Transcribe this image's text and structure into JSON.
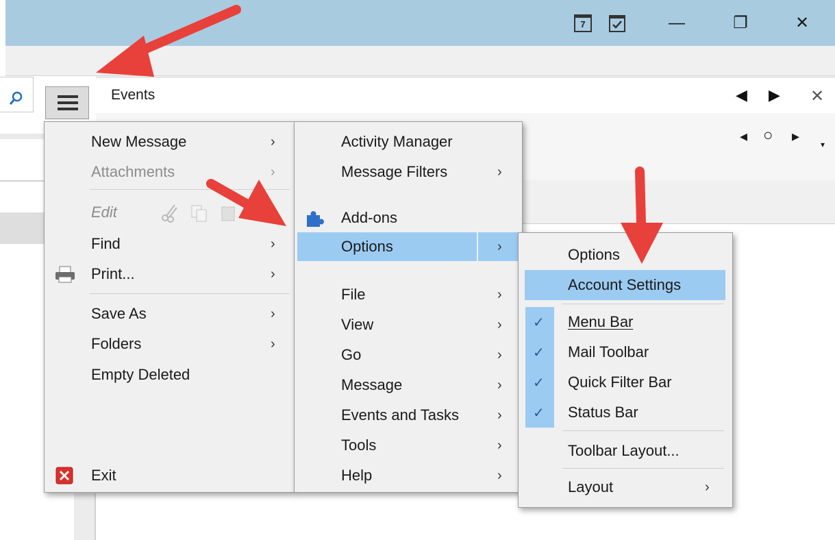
{
  "window": {
    "minimize_glyph": "—",
    "restore_glyph": "❐",
    "close_glyph": "✕"
  },
  "calendar_icons": {
    "calendar_day": "7"
  },
  "events": {
    "title": "Events",
    "prev_glyph": "◀",
    "next_glyph": "▶",
    "close_glyph": "✕",
    "mini_nav": {
      "prev": "◂",
      "today": "○",
      "next": "▸",
      "more": "▾"
    }
  },
  "main_menu": {
    "items": [
      {
        "label": "New Message",
        "arrow": "›"
      },
      {
        "label": "Attachments",
        "arrow": "›"
      },
      {
        "label": "Edit",
        "arrow": "›"
      },
      {
        "label": "Find",
        "arrow": "›"
      },
      {
        "label": "Print...",
        "arrow": "›"
      },
      {
        "label": "Save As",
        "arrow": "›"
      },
      {
        "label": "Folders",
        "arrow": "›"
      },
      {
        "label": "Empty Deleted"
      },
      {
        "label": "Exit"
      }
    ]
  },
  "sub_menu": {
    "items": [
      {
        "label": "Activity Manager"
      },
      {
        "label": "Message Filters",
        "arrow": "›"
      },
      {
        "label": "Add-ons"
      },
      {
        "label": "Options",
        "arrow": "›"
      },
      {
        "label": "File",
        "arrow": "›"
      },
      {
        "label": "View",
        "arrow": "›"
      },
      {
        "label": "Go",
        "arrow": "›"
      },
      {
        "label": "Message",
        "arrow": "›"
      },
      {
        "label": "Events and Tasks",
        "arrow": "›"
      },
      {
        "label": "Tools",
        "arrow": "›"
      },
      {
        "label": "Help",
        "arrow": "›"
      }
    ]
  },
  "options_menu": {
    "items": [
      {
        "label": "Options"
      },
      {
        "label": "Account Settings"
      },
      {
        "label": "Menu Bar",
        "checked": true,
        "access_key": "M"
      },
      {
        "label": "Mail Toolbar",
        "checked": true,
        "access_key": "o"
      },
      {
        "label": "Quick Filter Bar",
        "checked": true
      },
      {
        "label": "Status Bar",
        "checked": true,
        "access_key": "S"
      },
      {
        "label": "Toolbar Layout..."
      },
      {
        "label": "Layout",
        "arrow": "›"
      }
    ],
    "check_glyph": "✓"
  },
  "colors": {
    "title_bar": "#a8cbe0",
    "highlight": "#9ccbf2",
    "annotation_arrow": "#e8403a"
  }
}
